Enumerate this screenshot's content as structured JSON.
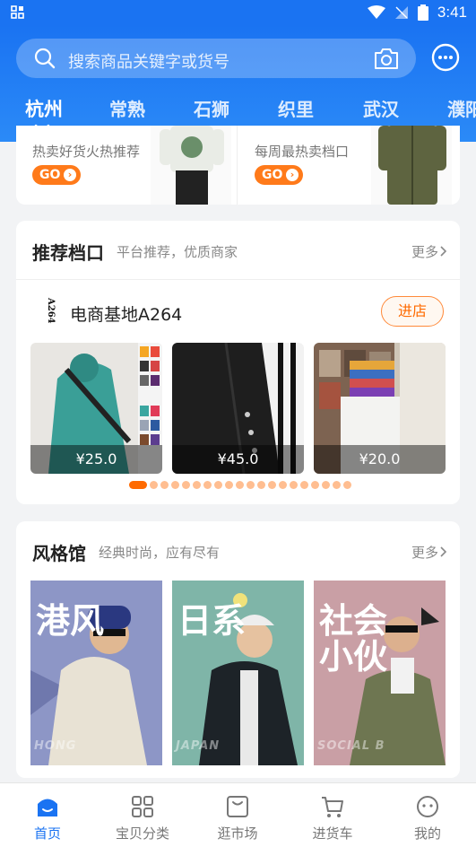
{
  "status_bar": {
    "time": "3:41"
  },
  "header": {
    "search_placeholder": "搜索商品关键字或货号",
    "cities": [
      "杭州",
      "常熟",
      "石狮",
      "织里",
      "武汉",
      "濮阳"
    ],
    "active_city_index": 0
  },
  "promo": {
    "left_text": "热卖好货火热推荐",
    "right_text": "每周最热卖档口",
    "go_label": "GO"
  },
  "recommended": {
    "title": "推荐档口",
    "subtitle": "平台推荐，优质商家",
    "more_label": "更多",
    "stall_logo_text": "A264",
    "stall_name": "电商基地A264",
    "enter_label": "进店",
    "products": [
      {
        "price": "¥25.0"
      },
      {
        "price": "¥45.0"
      },
      {
        "price": "¥20.0"
      }
    ],
    "dot_count": 20,
    "active_dot_index": 0
  },
  "style_hall": {
    "title": "风格馆",
    "subtitle": "经典时尚，应有尽有",
    "more_label": "更多",
    "tiles": [
      {
        "label": "港风",
        "ghost": "HONG"
      },
      {
        "label": "日系",
        "ghost": "JAPAN"
      },
      {
        "label": "社会\n小伙",
        "ghost": "SOCIAL B"
      }
    ]
  },
  "bottom_nav": {
    "items": [
      "首页",
      "宝贝分类",
      "逛市场",
      "进货车",
      "我的"
    ],
    "active_index": 0
  },
  "colors": {
    "brand_blue": "#1a73f2",
    "accent_orange": "#ff6a00"
  }
}
